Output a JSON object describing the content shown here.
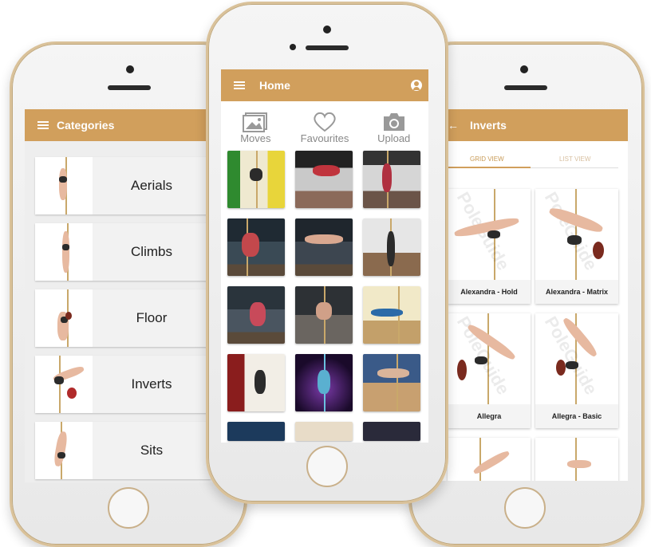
{
  "left_phone": {
    "title": "Categories",
    "categories": [
      "Aerials",
      "Climbs",
      "Floor",
      "Inverts",
      "Sits"
    ]
  },
  "center_phone": {
    "title": "Home",
    "actions": [
      {
        "label": "Moves",
        "icon": "image-icon"
      },
      {
        "label": "Favourites",
        "icon": "heart-icon"
      },
      {
        "label": "Upload",
        "icon": "camera-icon"
      }
    ],
    "tiles": 15
  },
  "right_phone": {
    "title": "Inverts",
    "tabs": [
      "GRID VIEW",
      "LIST VIEW"
    ],
    "active_tab": "GRID VIEW",
    "moves": [
      "Alexandra - Hold",
      "Alexandra - Matrix",
      "Allegra",
      "Allegra - Basic"
    ],
    "watermark": "PoleGuide"
  },
  "colors": {
    "accent": "#d19f5c",
    "phone_trim": "#d9c199"
  }
}
